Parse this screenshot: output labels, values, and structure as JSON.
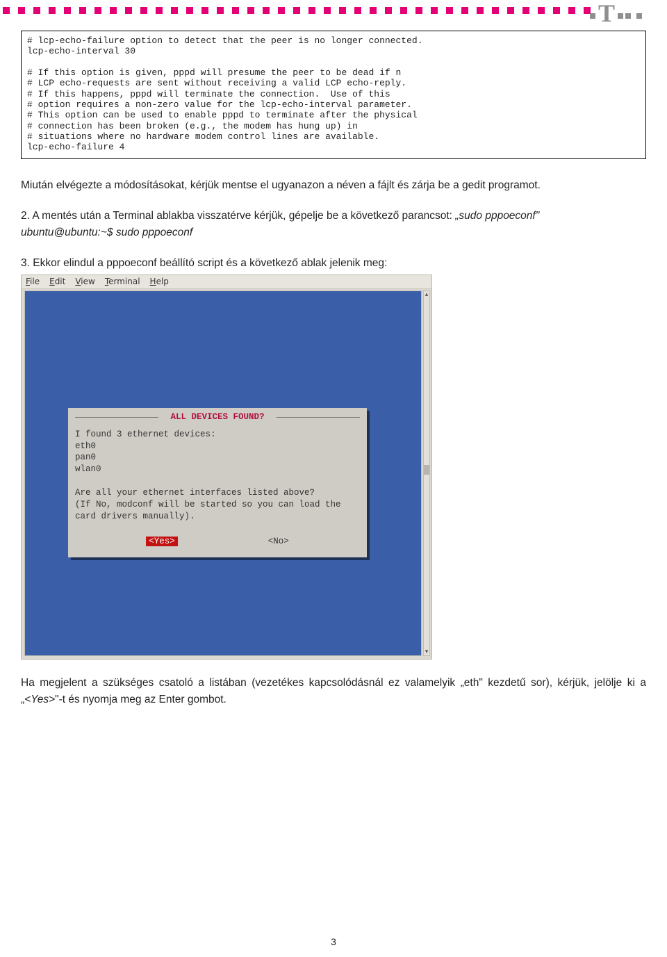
{
  "header": {
    "brand_letter": "T"
  },
  "codebox": "# lcp-echo-failure option to detect that the peer is no longer connected.\nlcp-echo-interval 30\n\n# If this option is given, pppd will presume the peer to be dead if n\n# LCP echo-requests are sent without receiving a valid LCP echo-reply.\n# If this happens, pppd will terminate the connection.  Use of this\n# option requires a non-zero value for the lcp-echo-interval parameter.\n# This option can be used to enable pppd to terminate after the physical\n# connection has been broken (e.g., the modem has hung up) in\n# situations where no hardware modem control lines are available.\nlcp-echo-failure 4",
  "para1": "Miután elvégezte a módosításokat, kérjük mentse el ugyanazon a néven a fájlt és zárja be a gedit programot.",
  "para2_lead": "2. A mentés után a Terminal ablakba visszatérve kérjük, gépelje be a következő parancsot: ",
  "para2_cmd1": "„sudo pppoeconf\"",
  "para2_prompt": "ubuntu@ubuntu:~$ sudo pppoeconf",
  "para3": "3. Ekkor elindul a pppoeconf beállító script és a következő ablak jelenik meg:",
  "terminal": {
    "menu": {
      "file": "File",
      "edit": "Edit",
      "view": "View",
      "terminal": "Terminal",
      "help": "Help"
    },
    "dialog": {
      "title": "ALL DEVICES FOUND?",
      "body": "I found 3 ethernet devices:\neth0\npan0\nwlan0\n\nAre all your ethernet interfaces listed above?\n(If No, modconf will be started so you can load the\ncard drivers manually).",
      "yes": "<Yes>",
      "no": "<No>"
    }
  },
  "para4_a": "Ha megjelent a szükséges csatoló a listában (vezetékes kapcsolódásnál ez valamelyik „eth\" kezdetű sor), kérjük, jelölje ki a „",
  "para4_yes": "<Yes>",
  "para4_b": "\"-t és nyomja meg az Enter gombot.",
  "page_number": "3"
}
